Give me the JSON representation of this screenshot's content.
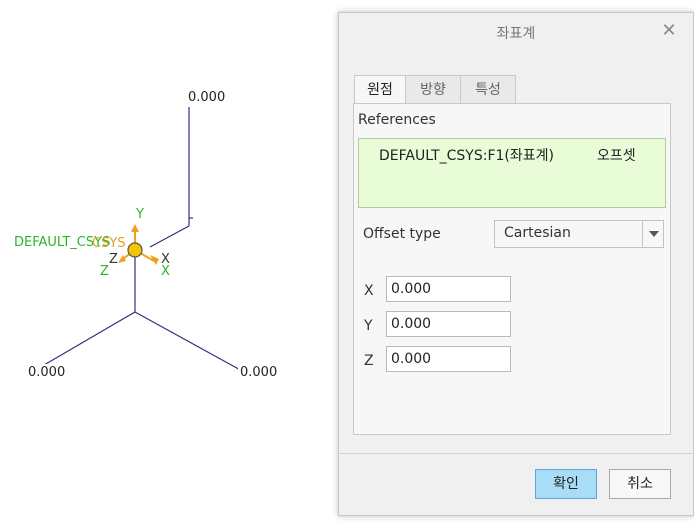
{
  "viewport": {
    "dimension_top": "0.000",
    "dimension_left": "0.000",
    "dimension_right": "0.000",
    "csys_label_green": "DEFAULT_CSYS",
    "csys_label_orange": "CSYS",
    "axis_y": "Y",
    "axis_z_dark": "Z",
    "axis_x_dark": "X",
    "axis_z_green": "Z",
    "axis_x_green": "X",
    "colors": {
      "line": "#3a2a80",
      "origin_marker": "#f5c400",
      "axis_arrow": "#f0a020",
      "label_green": "#2bb52b"
    }
  },
  "dialog": {
    "title": "좌표계",
    "close_icon": "close-icon",
    "tabs": [
      {
        "label": "원점",
        "active": true
      },
      {
        "label": "방향",
        "active": false
      },
      {
        "label": "특성",
        "active": false
      }
    ],
    "references_label": "References",
    "reference": {
      "name": "DEFAULT_CSYS:F1(좌표계)",
      "type": "오프셋"
    },
    "offset_type_label": "Offset type",
    "offset_type_value": "Cartesian",
    "coords": [
      {
        "label": "X",
        "value": "0.000"
      },
      {
        "label": "Y",
        "value": "0.000"
      },
      {
        "label": "Z",
        "value": "0.000"
      }
    ],
    "ok_label": "확인",
    "cancel_label": "취소",
    "colors": {
      "reference_bg": "#e8fcd8",
      "ok_button": "#a9dcf7"
    }
  }
}
